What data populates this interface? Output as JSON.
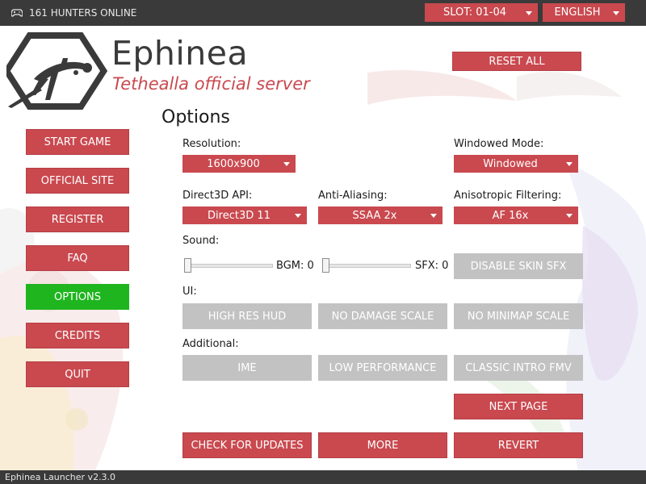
{
  "topbar": {
    "online_text": "161 HUNTERS ONLINE",
    "slot_value": "SLOT: 01-04",
    "language_value": "ENGLISH"
  },
  "logo": {
    "title": "Ephinea",
    "subtitle": "Tethealla official server"
  },
  "reset_all_label": "RESET ALL",
  "nav": {
    "start_game": "START GAME",
    "official_site": "OFFICIAL SITE",
    "register": "REGISTER",
    "faq": "FAQ",
    "options": "OPTIONS",
    "credits": "CREDITS",
    "quit": "QUIT",
    "active": "OPTIONS"
  },
  "options": {
    "title": "Options",
    "resolution_label": "Resolution:",
    "resolution_value": "1600x900",
    "windowed_label": "Windowed Mode:",
    "windowed_value": "Windowed",
    "d3d_label": "Direct3D API:",
    "d3d_value": "Direct3D 11",
    "aa_label": "Anti-Aliasing:",
    "aa_value": "SSAA 2x",
    "af_label": "Anisotropic Filtering:",
    "af_value": "AF 16x",
    "sound_label": "Sound:",
    "bgm_label": "BGM: 0",
    "bgm_value": 0,
    "sfx_label": "SFX: 0",
    "sfx_value": 0,
    "disable_skin_sfx": "DISABLE SKIN SFX",
    "ui_label": "UI:",
    "high_res_hud": "HIGH RES HUD",
    "no_damage_scale": "NO DAMAGE SCALE",
    "no_minimap_scale": "NO MINIMAP SCALE",
    "additional_label": "Additional:",
    "ime": "IME",
    "low_performance": "LOW PERFORMANCE",
    "classic_intro_fmv": "CLASSIC INTRO FMV",
    "next_page": "NEXT PAGE",
    "check_for_updates": "CHECK FOR UPDATES",
    "more": "MORE",
    "revert": "REVERT"
  },
  "statusbar": {
    "version": "Ephinea Launcher v2.3.0"
  },
  "colors": {
    "accent": "#c9494f",
    "active": "#1fb51f",
    "disabled": "#c2c2c2",
    "bar": "#3a3a3a"
  },
  "icons": {
    "online": "gamepad-icon",
    "logo": "hexagon-ship-logo",
    "dropdown": "caret-down-icon"
  }
}
